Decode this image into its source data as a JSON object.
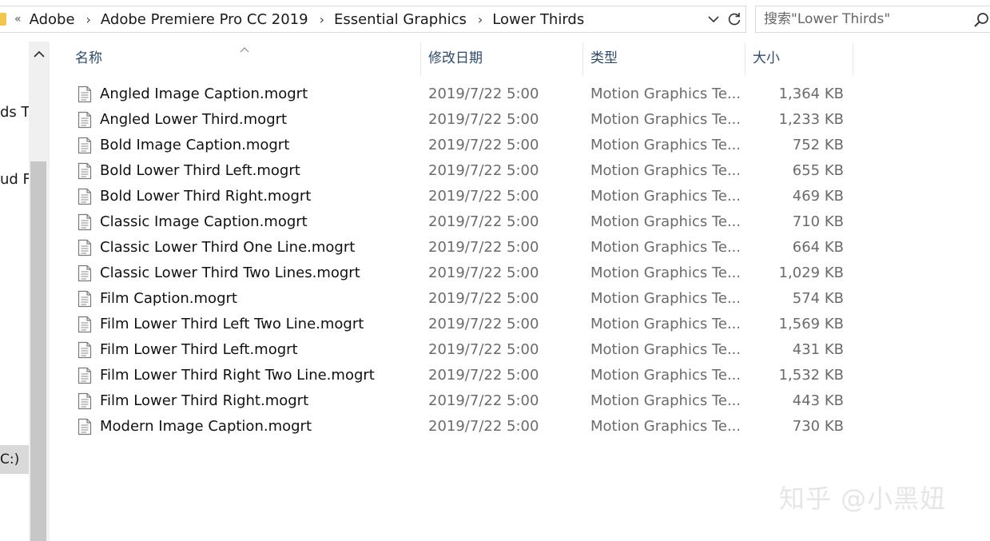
{
  "address_bar": {
    "overflow_label": "«",
    "crumbs": [
      "Adobe",
      "Adobe Premiere Pro CC 2019",
      "Essential Graphics",
      "Lower Thirds"
    ],
    "separator": "›"
  },
  "search": {
    "placeholder": "搜索\"Lower Thirds\""
  },
  "nav_pane": {
    "items": [
      {
        "label": "ds Ti"
      },
      {
        "label": "ud Fi"
      }
    ],
    "selected_item": "C:)"
  },
  "columns": {
    "name": "名称",
    "date": "修改日期",
    "type": "类型",
    "size": "大小",
    "sorted_column": "name"
  },
  "files": [
    {
      "name": "Angled Image Caption.mogrt",
      "date": "2019/7/22 5:00",
      "type": "Motion Graphics Te...",
      "size": "1,364 KB"
    },
    {
      "name": "Angled Lower Third.mogrt",
      "date": "2019/7/22 5:00",
      "type": "Motion Graphics Te...",
      "size": "1,233 KB"
    },
    {
      "name": "Bold Image Caption.mogrt",
      "date": "2019/7/22 5:00",
      "type": "Motion Graphics Te...",
      "size": "752 KB"
    },
    {
      "name": "Bold Lower Third Left.mogrt",
      "date": "2019/7/22 5:00",
      "type": "Motion Graphics Te...",
      "size": "655 KB"
    },
    {
      "name": "Bold Lower Third Right.mogrt",
      "date": "2019/7/22 5:00",
      "type": "Motion Graphics Te...",
      "size": "469 KB"
    },
    {
      "name": "Classic Image Caption.mogrt",
      "date": "2019/7/22 5:00",
      "type": "Motion Graphics Te...",
      "size": "710 KB"
    },
    {
      "name": "Classic Lower Third One Line.mogrt",
      "date": "2019/7/22 5:00",
      "type": "Motion Graphics Te...",
      "size": "664 KB"
    },
    {
      "name": "Classic Lower Third Two Lines.mogrt",
      "date": "2019/7/22 5:00",
      "type": "Motion Graphics Te...",
      "size": "1,029 KB"
    },
    {
      "name": "Film Caption.mogrt",
      "date": "2019/7/22 5:00",
      "type": "Motion Graphics Te...",
      "size": "574 KB"
    },
    {
      "name": "Film Lower Third Left Two Line.mogrt",
      "date": "2019/7/22 5:00",
      "type": "Motion Graphics Te...",
      "size": "1,569 KB"
    },
    {
      "name": "Film Lower Third Left.mogrt",
      "date": "2019/7/22 5:00",
      "type": "Motion Graphics Te...",
      "size": "431 KB"
    },
    {
      "name": "Film Lower Third Right Two Line.mogrt",
      "date": "2019/7/22 5:00",
      "type": "Motion Graphics Te...",
      "size": "1,532 KB"
    },
    {
      "name": "Film Lower Third Right.mogrt",
      "date": "2019/7/22 5:00",
      "type": "Motion Graphics Te...",
      "size": "443 KB"
    },
    {
      "name": "Modern Image Caption.mogrt",
      "date": "2019/7/22 5:00",
      "type": "Motion Graphics Te...",
      "size": "730 KB"
    }
  ],
  "icons": {
    "file": "document-icon",
    "search": "search-icon",
    "refresh": "refresh-icon",
    "dropdown": "chevron-down-icon",
    "scroll_up": "chevron-up-icon"
  },
  "watermark": {
    "text": "知乎 @小黑妞"
  },
  "colors": {
    "header_text": "#2e4a6b",
    "secondary_text": "#6b6b6b",
    "folder": "#f3c54a",
    "selection": "#d9d9d9"
  }
}
